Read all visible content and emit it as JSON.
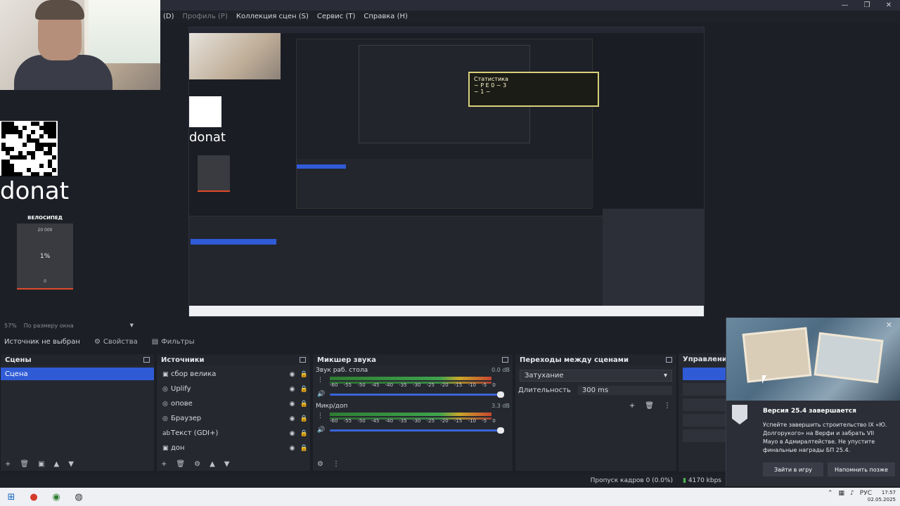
{
  "menu": {
    "d": "(D)",
    "profiles": "Профиль (P)",
    "scene_collection": "Коллекция сцен (S)",
    "service": "Сервис (T)",
    "help": "Справка (H)"
  },
  "window": {
    "min": "—",
    "max": "❐",
    "close": "✕"
  },
  "overlay": {
    "donat": "donat",
    "bike_title": "ВЕЛОСИПЕД",
    "bike_goal": "20 000",
    "bike_percent": "1%",
    "bike_current": "0"
  },
  "preview_stats": {
    "title": "Статистика",
    "line1": "~ P E 0 ~ 3",
    "line2": "~ 1 ~"
  },
  "zoom": {
    "percent": "57%",
    "mode": "По размеру окна"
  },
  "source_bar": {
    "no_source": "Источник не выбран",
    "properties": "Свойства",
    "filters": "Фильтры"
  },
  "scenes": {
    "title": "Сцены",
    "items": [
      "Сцена"
    ]
  },
  "sources": {
    "title": "Источники",
    "items": [
      {
        "icon": "image-icon",
        "name": "сбор велика"
      },
      {
        "icon": "browser-icon",
        "name": "Uplify"
      },
      {
        "icon": "browser-icon",
        "name": "опове"
      },
      {
        "icon": "browser-icon",
        "name": "Браузер"
      },
      {
        "icon": "text-icon",
        "name": "Текст (GDI+)"
      },
      {
        "icon": "image-icon",
        "name": "дон"
      }
    ]
  },
  "mixer": {
    "title": "Микшер звука",
    "channels": [
      {
        "name": "Звук раб. стола",
        "db": "0.0 dB"
      },
      {
        "name": "Микр/доп",
        "db": "3.3 dB"
      }
    ],
    "scale": [
      "-60",
      "-55",
      "-50",
      "-45",
      "-40",
      "-35",
      "-30",
      "-25",
      "-20",
      "-15",
      "-10",
      "-5",
      "0"
    ]
  },
  "transitions": {
    "title": "Переходы между сценами",
    "selected": "Затухание",
    "duration_label": "Длительность",
    "duration_value": "300 ms"
  },
  "controls": {
    "title": "Управление"
  },
  "notification": {
    "title": "Версия 25.4 завершается",
    "body": "Успейте завершить строительство IX «Ю. Долгорукого» на Верфи и забрать VII Мауо в Адмиралтействе. Не упустите финальные награды БП 25.4.",
    "btn_play": "Зайти в игру",
    "btn_later": "Напомнить позже",
    "close": "✕"
  },
  "status": {
    "dropped": "Пропуск кадров 0 (0.0%)",
    "bitrate": "4170 kbps"
  },
  "taskbar": {
    "time": "17:57",
    "date": "02.05.2025",
    "lang": "РУС"
  },
  "colors": {
    "accent": "#2f5bd6",
    "panel": "#262830",
    "bg": "#1d1f26"
  }
}
